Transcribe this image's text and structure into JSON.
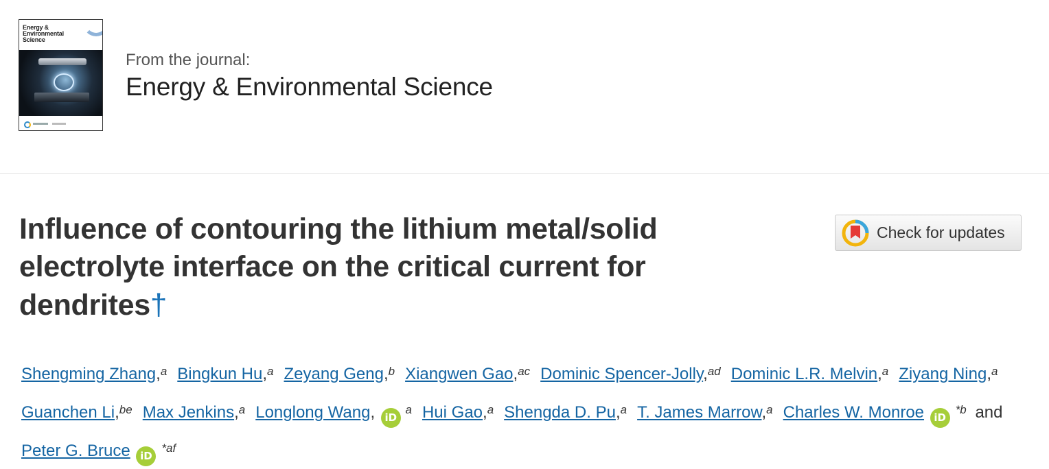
{
  "journal": {
    "cover_title": "Energy & Environmental Science",
    "from_label": "From the journal:",
    "name": "Energy & Environmental Science"
  },
  "article": {
    "title": "Influence of contouring the lithium metal/solid electrolyte interface on the critical current for dendrites",
    "footnote_mark": "†"
  },
  "check_updates": {
    "label": "Check for updates",
    "icon": "crossmark-icon"
  },
  "authors": [
    {
      "name": "Shengming Zhang",
      "aff": "a"
    },
    {
      "name": "Bingkun Hu",
      "aff": "a"
    },
    {
      "name": "Zeyang Geng",
      "aff": "b"
    },
    {
      "name": "Xiangwen Gao",
      "aff": "ac"
    },
    {
      "name": "Dominic Spencer-Jolly",
      "aff": "ad"
    },
    {
      "name": "Dominic L.R. Melvin",
      "aff": "a"
    },
    {
      "name": "Ziyang Ning",
      "aff": "a"
    },
    {
      "name": "Guanchen Li",
      "aff": "be"
    },
    {
      "name": "Max Jenkins",
      "aff": "a"
    },
    {
      "name": "Longlong Wang",
      "aff": "a",
      "orcid": true
    },
    {
      "name": "Hui Gao",
      "aff": "a"
    },
    {
      "name": "Shengda D. Pu",
      "aff": "a"
    },
    {
      "name": "T. James Marrow",
      "aff": "a"
    },
    {
      "name": "Charles W. Monroe",
      "aff": "*b",
      "orcid": true
    },
    {
      "name": "Peter G. Bruce",
      "aff": "*af",
      "orcid": true
    }
  ],
  "authors_and": "and",
  "orcid_label": "iD",
  "colors": {
    "link": "#1565a3",
    "orcid": "#a6ce39",
    "dagger": "#1a73b8"
  }
}
